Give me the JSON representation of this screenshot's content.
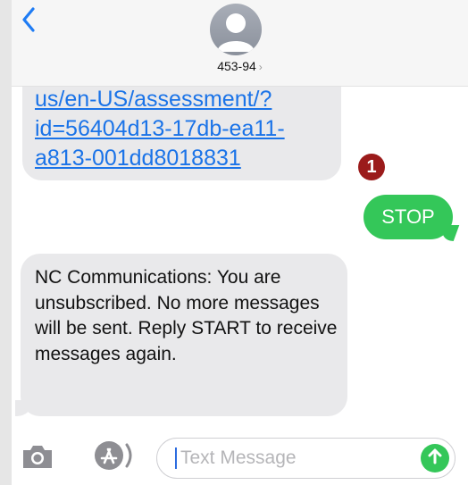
{
  "header": {
    "contact_number": "453-94",
    "contact_chevron": "›"
  },
  "messages": {
    "link_text": "us/en-US/assessment/?\nid=56404d13-17db-ea11-\na813-001dd8018831",
    "annotation_badge": "1",
    "sent_text": "STOP",
    "reply_text": "NC Communications: You are unsubscribed. No more messages will be sent. Reply START to receive messages again."
  },
  "composer": {
    "placeholder": "Text Message"
  },
  "colors": {
    "sent_bubble": "#34c759",
    "received_bubble": "#e9e9eb",
    "link": "#1a73e8",
    "badge": "#9b1b1b",
    "back_chevron": "#1f7cf4"
  },
  "icons": [
    "back-chevron-icon",
    "contact-avatar-icon",
    "camera-icon",
    "app-store-icon",
    "send-arrow-icon"
  ]
}
